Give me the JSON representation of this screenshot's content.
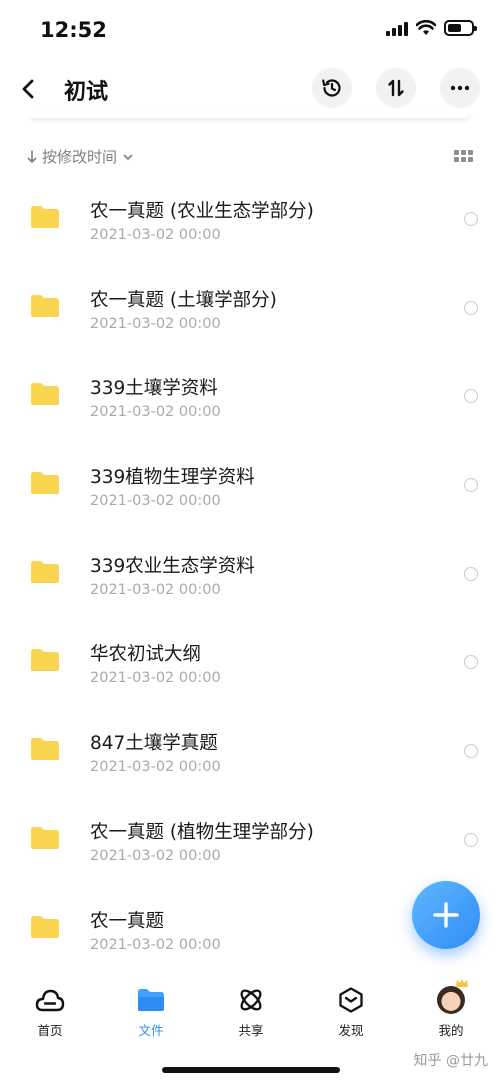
{
  "status_bar": {
    "time": "12:52"
  },
  "header": {
    "title": "初试",
    "icons": [
      "back-icon",
      "history-icon",
      "sort-swap-icon",
      "more-icon"
    ]
  },
  "sort": {
    "label": "按修改时间"
  },
  "files": [
    {
      "name": "农一真题 (农业生态学部分)",
      "date": "2021-03-02 00:00"
    },
    {
      "name": "农一真题 (土壤学部分)",
      "date": "2021-03-02 00:00"
    },
    {
      "name": "339土壤学资料",
      "date": "2021-03-02 00:00"
    },
    {
      "name": "339植物生理学资料",
      "date": "2021-03-02 00:00"
    },
    {
      "name": "339农业生态学资料",
      "date": "2021-03-02 00:00"
    },
    {
      "name": "华农初试大纲",
      "date": "2021-03-02 00:00"
    },
    {
      "name": "847土壤学真题",
      "date": "2021-03-02 00:00"
    },
    {
      "name": "农一真题 (植物生理学部分)",
      "date": "2021-03-02 00:00"
    },
    {
      "name": "农一真题",
      "date": "2021-03-02 00:00"
    }
  ],
  "tabs": [
    {
      "label": "首页",
      "icon": "home-cloud-icon",
      "active": false
    },
    {
      "label": "文件",
      "icon": "folder-icon",
      "active": true
    },
    {
      "label": "共享",
      "icon": "share-atom-icon",
      "active": false
    },
    {
      "label": "发现",
      "icon": "discover-icon",
      "active": false
    },
    {
      "label": "我的",
      "icon": "avatar",
      "active": false
    }
  ],
  "watermark": "知乎 @廿九",
  "colors": {
    "accent": "#2f8cf5",
    "folder": "#f9d44e",
    "muted": "#a7aab0"
  }
}
